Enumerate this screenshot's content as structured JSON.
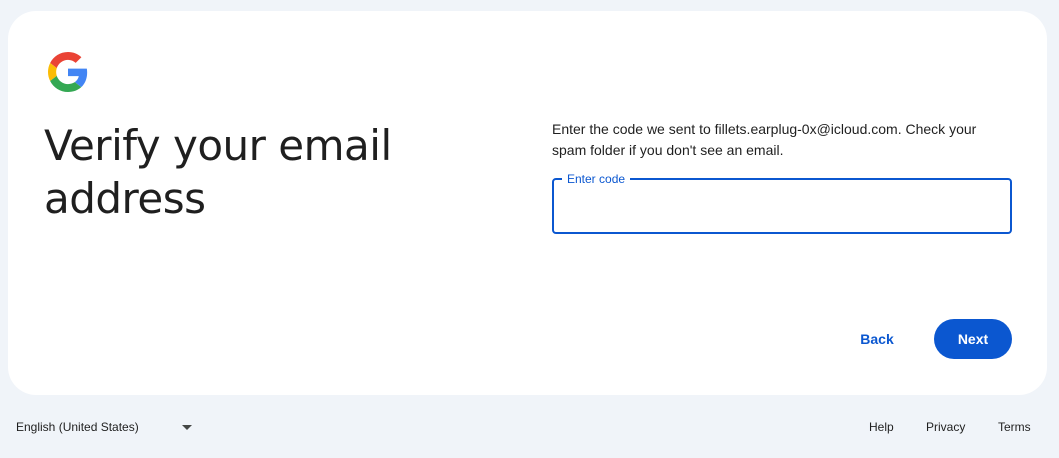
{
  "header": {
    "logo_icon": "google-g-logo-icon",
    "title": "Verify your email address"
  },
  "main": {
    "instructions": "Enter the code we sent to fillets.earplug-0x@icloud.com. Check your spam folder if you don't see an email.",
    "code_field": {
      "label": "Enter code",
      "value": ""
    },
    "back_label": "Back",
    "next_label": "Next"
  },
  "footer": {
    "language": "English (United States)",
    "language_icon": "caret-down-icon",
    "help_label": "Help",
    "privacy_label": "Privacy",
    "terms_label": "Terms"
  },
  "colors": {
    "page_background": "#f0f4f9",
    "card_background": "#ffffff",
    "accent": "#0b57d0",
    "text": "#1f1f1f",
    "google_blue": "#4285f4",
    "google_red": "#ea4335",
    "google_yellow": "#fbbc05",
    "google_green": "#34a853"
  }
}
